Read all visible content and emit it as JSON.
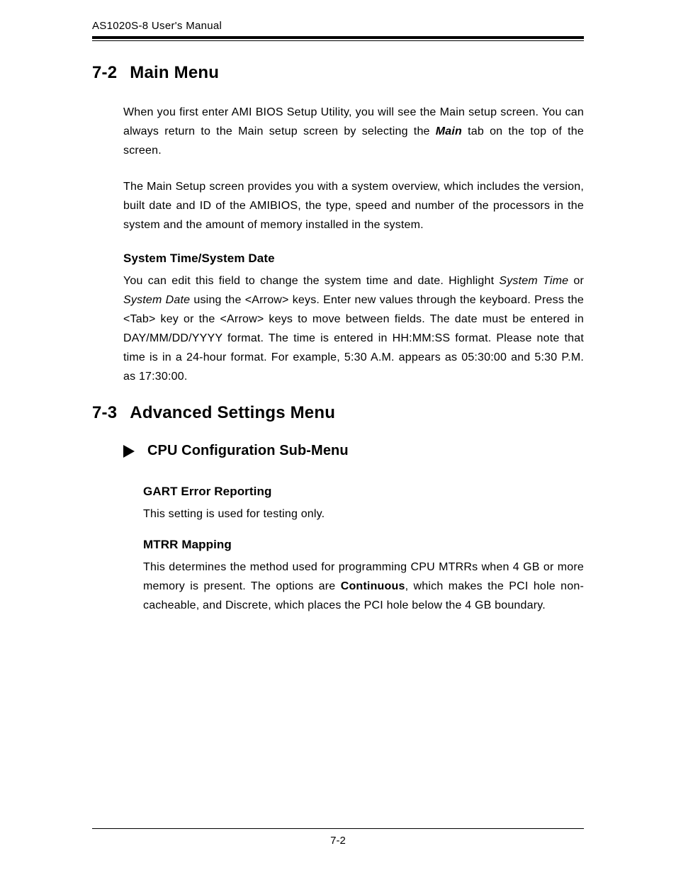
{
  "header": {
    "title": "AS1020S-8 User's Manual"
  },
  "sections": {
    "s72": {
      "number": "7-2",
      "title": "Main Menu",
      "p1_a": "When you first enter AMI BIOS Setup Utility, you will see the Main setup screen.  You can always return to the Main setup screen by selecting the ",
      "p1_main": "Main",
      "p1_b": " tab on the top of the screen.",
      "p2": "The Main Setup screen provides you with a system overview, which includes the version, built date and ID of the AMIBIOS, the type, speed and number of the processors in the system and the amount of memory installed in the system.",
      "h3": "System Time/System Date",
      "p3_a": "You can edit this field to change the system time and date. Highlight ",
      "p3_st": "System Time",
      "p3_b": " or ",
      "p3_sd": "System Date",
      "p3_c": " using the <Arrow> keys.  Enter new values through the keyboard. Press the <Tab> key or the <Arrow> keys to move between fields.  The date must be entered in DAY/MM/DD/YYYY format. The time is entered in HH:MM:SS format.  Please note that time is in a 24-hour format.  For example, 5:30 A.M. appears as 05:30:00 and 5:30 P.M. as 17:30:00."
    },
    "s73": {
      "number": "7-3",
      "title": "Advanced Settings Menu",
      "sub_title": "CPU Configuration Sub-Menu",
      "gart_h": "GART Error Reporting",
      "gart_p": "This setting is used for testing only.",
      "mtrr_h": "MTRR Mapping",
      "mtrr_a": "This determines the method used for programming CPU MTRRs when 4 GB or more memory is present.  The options are ",
      "mtrr_bold": "Continuous",
      "mtrr_b": ", which makes the PCI hole non-cacheable, and Discrete, which places the PCI hole below the 4 GB boundary."
    }
  },
  "footer": {
    "page_number": "7-2"
  }
}
